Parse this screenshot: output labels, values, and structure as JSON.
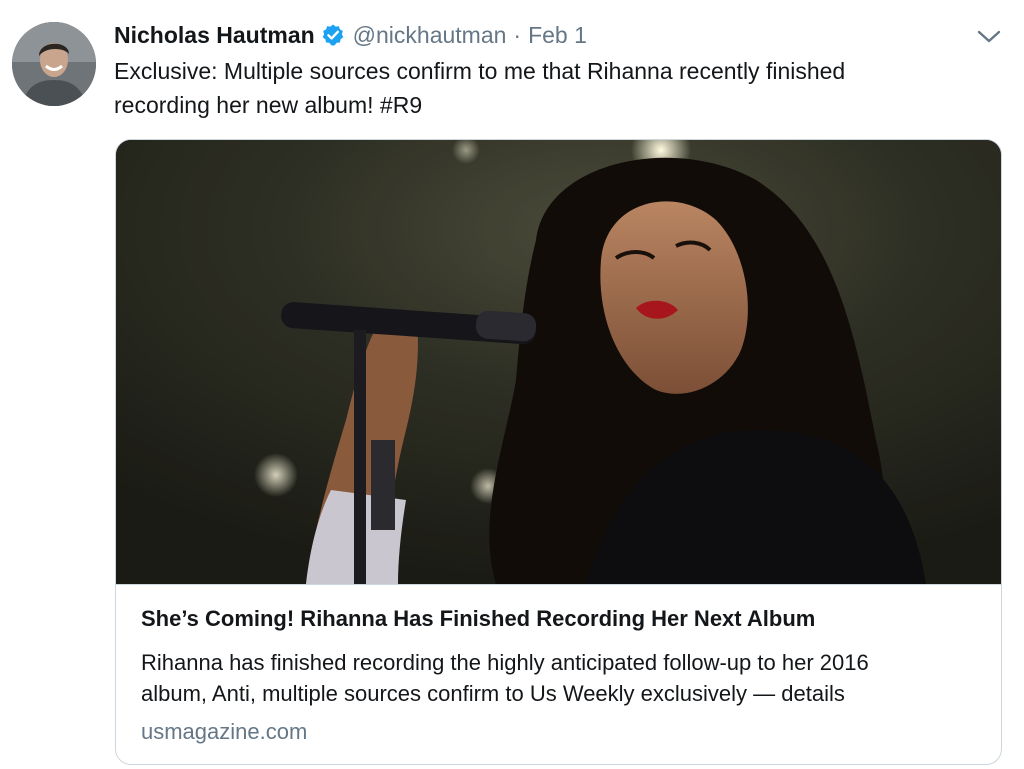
{
  "tweet": {
    "author": {
      "name": "Nicholas Hautman",
      "handle": "@nickhautman",
      "verified_icon": "verified-badge-icon",
      "avatar_icon": "profile-photo"
    },
    "separator": "·",
    "date": "Feb 1",
    "menu_icon": "chevron-down-icon",
    "text_lines": [
      "Exclusive: Multiple sources confirm to me that Rihanna recently finished",
      "recording her new album! "
    ],
    "hashtag": "#R9"
  },
  "card": {
    "image_icon": "article-photo",
    "title": "She’s Coming! Rihanna Has Finished Recording Her Next Album",
    "description_lines": [
      "Rihanna has finished recording the highly anticipated follow-up to her 2016",
      "album, Anti, multiple sources confirm to Us Weekly exclusively — details"
    ],
    "domain": "usmagazine.com"
  },
  "colors": {
    "text": "#14171a",
    "secondary_text": "#657786",
    "verified_blue": "#1da1f2",
    "border": "#ccd6dd"
  }
}
